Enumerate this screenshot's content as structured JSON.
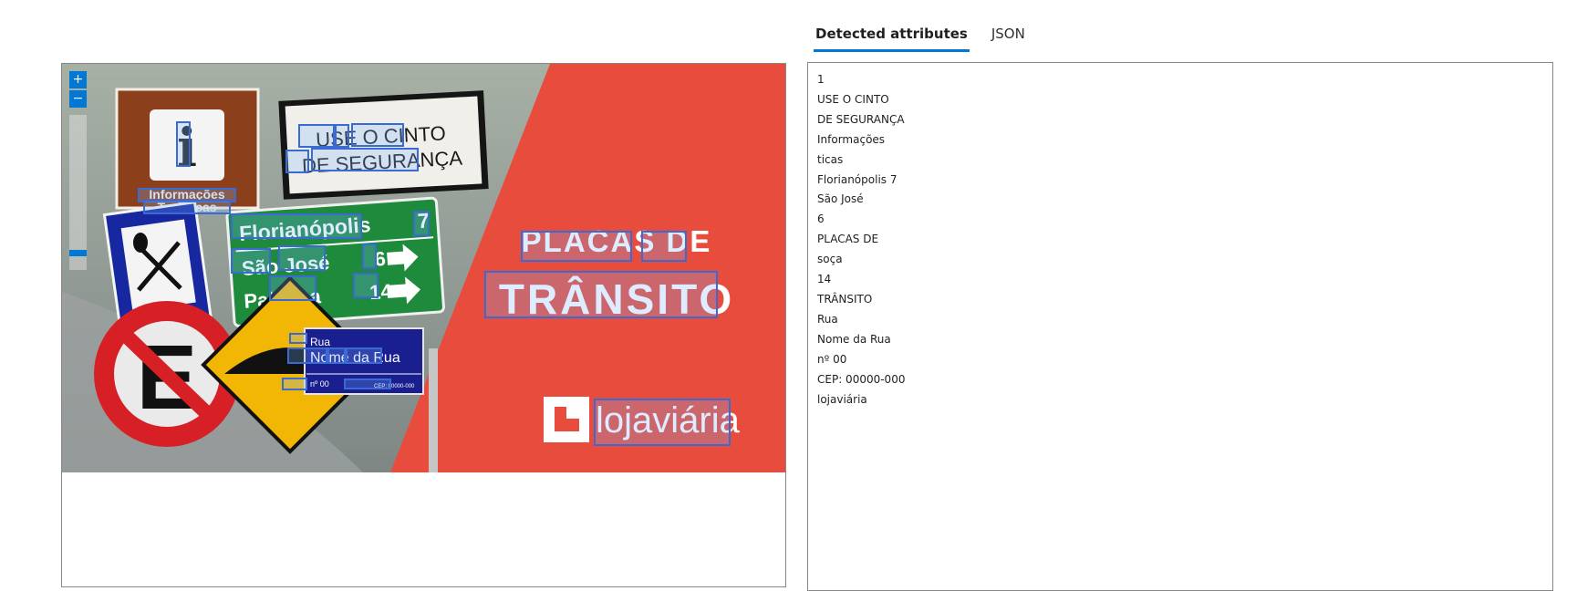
{
  "tabs": [
    {
      "label": "Detected attributes",
      "active": true
    },
    {
      "label": "JSON",
      "active": false
    }
  ],
  "zoom": {
    "in_label": "+",
    "out_label": "−"
  },
  "detected_lines": [
    "1",
    "USE O CINTO",
    "DE SEGURANÇA",
    "Informações",
    "ticas",
    "Florianópolis 7",
    "São José",
    "6",
    "PLACAS DE",
    "soça",
    "14",
    "TRÂNSITO",
    "Rua",
    "Nome da Rua",
    "nº 00",
    "CEP: 00000-000",
    "lojaviária"
  ],
  "image_text": {
    "info_letter": "i",
    "info_line1": "Informações",
    "info_line2": "Turísticas",
    "seatbelt_line1": "USE O CINTO",
    "seatbelt_line2": "DE SEGURANÇA",
    "dest1_name": "Florianópolis",
    "dest1_km": "7",
    "dest2_name": "São José",
    "dest2_km": "6",
    "dest3_name": "Palhoça",
    "dest3_km": "14",
    "title1": "PLACAS DE",
    "title2": "TRÂNSITO",
    "street_top": "Rua",
    "street_name": "Nome da Rua",
    "street_num": "nº 00",
    "street_cep": "CEP: 00000-000",
    "brand": "lojaviária"
  },
  "colors": {
    "accent": "#0078d4",
    "banner_red": "#e84c3d",
    "green_sign": "#1e8a3c",
    "brown_sign": "#8b3f1a",
    "blue_sign": "#1627a0",
    "yellow_sign": "#f2b705"
  }
}
